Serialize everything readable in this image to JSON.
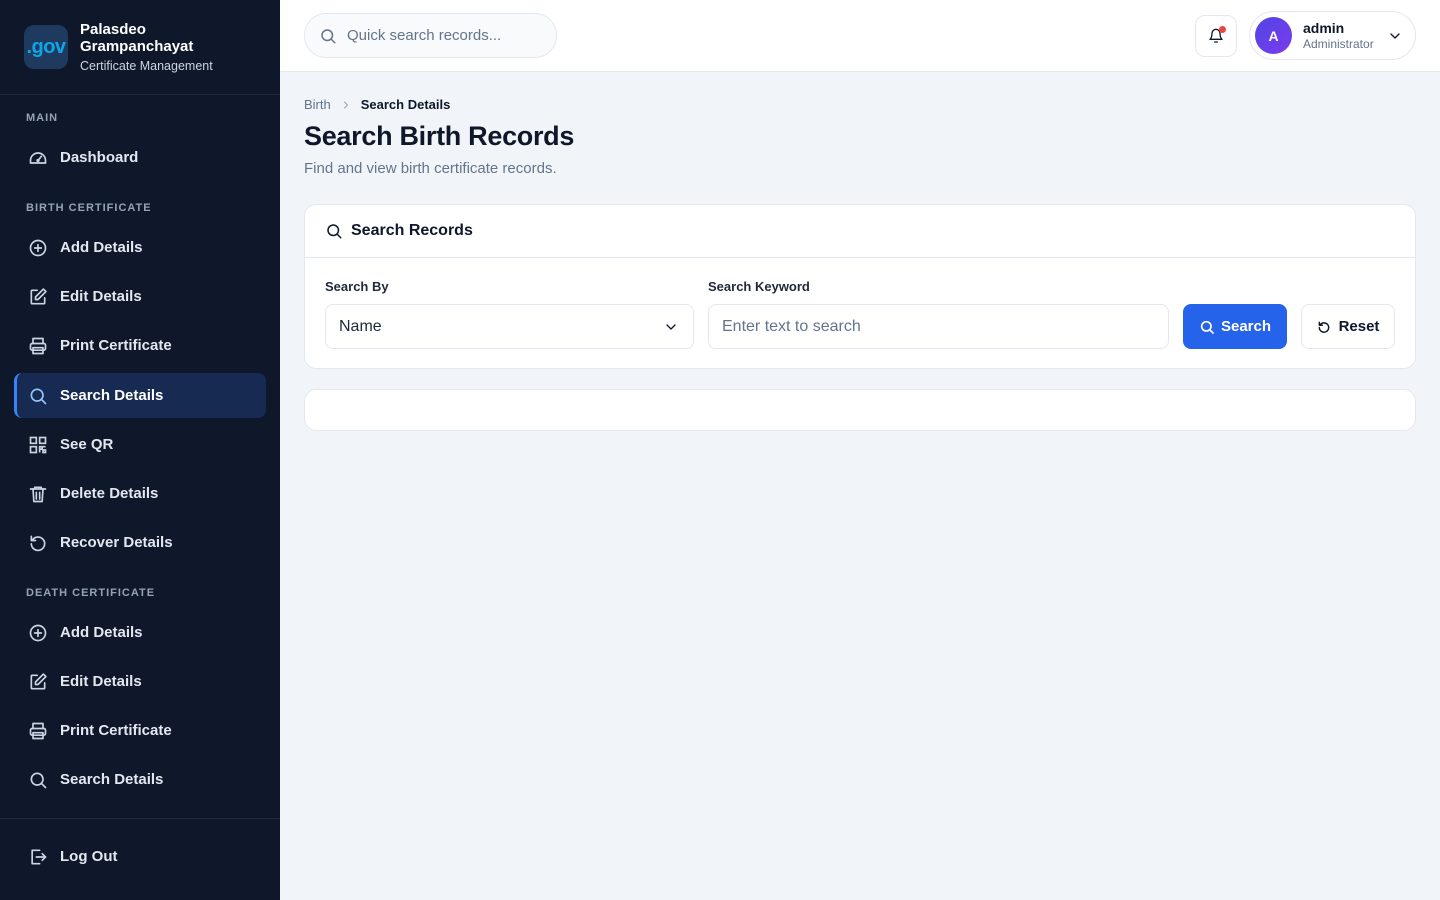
{
  "brand": {
    "logo_text": ".gov",
    "title_line1": "Palasdeo",
    "title_line2": "Grampanchayat",
    "subtitle": "Certificate Management"
  },
  "sidebar": {
    "sections": {
      "main": "MAIN",
      "birth": "BIRTH CERTIFICATE",
      "death": "DEATH CERTIFICATE"
    },
    "main_items": [
      {
        "label": "Dashboard",
        "icon": "dashboard-icon"
      }
    ],
    "birth_items": [
      {
        "label": "Add Details",
        "icon": "plus-circle-icon"
      },
      {
        "label": "Edit Details",
        "icon": "edit-icon"
      },
      {
        "label": "Print Certificate",
        "icon": "printer-icon"
      },
      {
        "label": "Search Details",
        "icon": "search-icon",
        "active": true
      },
      {
        "label": "See QR",
        "icon": "qr-code-icon"
      },
      {
        "label": "Delete Details",
        "icon": "trash-icon"
      },
      {
        "label": "Recover Details",
        "icon": "rotate-ccw-icon"
      }
    ],
    "death_items": [
      {
        "label": "Add Details",
        "icon": "plus-circle-icon"
      },
      {
        "label": "Edit Details",
        "icon": "edit-icon"
      },
      {
        "label": "Print Certificate",
        "icon": "printer-icon"
      },
      {
        "label": "Search Details",
        "icon": "search-icon"
      }
    ],
    "logout": {
      "label": "Log Out",
      "icon": "logout-icon"
    }
  },
  "topbar": {
    "search_placeholder": "Quick search records...",
    "user": {
      "initial": "A",
      "name": "admin",
      "role": "Administrator"
    }
  },
  "breadcrumb": {
    "parent": "Birth",
    "current": "Search Details"
  },
  "page": {
    "title": "Search Birth Records",
    "subtitle": "Find and view birth certificate records."
  },
  "search_card": {
    "title": "Search Records",
    "search_by_label": "Search By",
    "search_by_value": "Name",
    "keyword_label": "Search Keyword",
    "keyword_placeholder": "Enter text to search",
    "search_button": "Search",
    "reset_button": "Reset"
  },
  "colors": {
    "sidebar_bg": "#0f172a",
    "accent": "#2563eb",
    "page_bg": "#f1f5f9",
    "notification_dot": "#ef4444"
  }
}
